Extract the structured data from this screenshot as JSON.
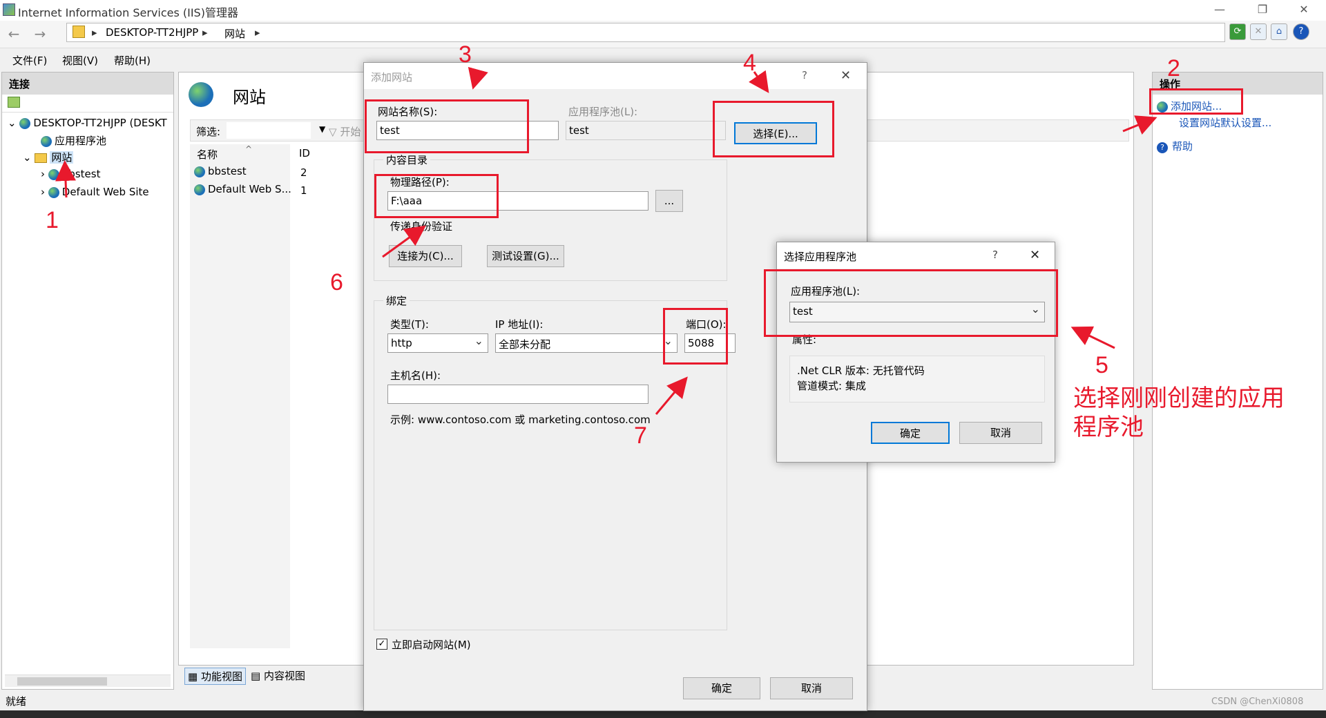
{
  "window": {
    "title": "Internet Information Services (IIS)管理器"
  },
  "address": {
    "crumbs": [
      "DESKTOP-TT2HJPP",
      "网站"
    ]
  },
  "menu": [
    "文件(F)",
    "视图(V)",
    "帮助(H)"
  ],
  "left": {
    "header": "连接",
    "tree": [
      "DESKTOP-TT2HJPP (DESKT",
      "应用程序池",
      "网站",
      "bbstest",
      "Default Web Site"
    ]
  },
  "center": {
    "title": "网站",
    "filter_label": "筛选:",
    "filter_go": "开始",
    "columns": [
      "名称",
      "ID"
    ],
    "rows": [
      {
        "name": "bbstest",
        "id": "2"
      },
      {
        "name": "Default Web S...",
        "id": "1"
      }
    ],
    "tabs": [
      "功能视图",
      "内容视图"
    ]
  },
  "right": {
    "header": "操作",
    "actions": [
      "添加网站...",
      "设置网站默认设置...",
      "帮助"
    ]
  },
  "status": "就绪",
  "add_site": {
    "title": "添加网站",
    "site_name_label": "网站名称(S):",
    "site_name": "test",
    "app_pool_label": "应用程序池(L):",
    "app_pool": "test",
    "select_btn": "选择(E)...",
    "content_dir": "内容目录",
    "physical_path_label": "物理路径(P):",
    "physical_path": "F:\\aaa",
    "browse_btn": "...",
    "pass_auth": "传递身份验证",
    "connect_as_btn": "连接为(C)...",
    "test_settings_btn": "测试设置(G)...",
    "binding": "绑定",
    "type_label": "类型(T):",
    "type": "http",
    "ip_label": "IP 地址(I):",
    "ip": "全部未分配",
    "port_label": "端口(O):",
    "port": "5088",
    "host_label": "主机名(H):",
    "host": "",
    "example": "示例: www.contoso.com 或 marketing.contoso.com",
    "start_now": "立即启动网站(M)",
    "ok": "确定",
    "cancel": "取消"
  },
  "select_pool": {
    "title": "选择应用程序池",
    "pool_label": "应用程序池(L):",
    "pool": "test",
    "props_label": "属性:",
    "clr": ".Net CLR 版本: 无托管代码",
    "pipeline": "管道模式: 集成",
    "ok": "确定",
    "cancel": "取消"
  },
  "annotations": {
    "n1": "1",
    "n2": "2",
    "n3": "3",
    "n4": "4",
    "n5": "5",
    "n6": "6",
    "n7": "7",
    "note": "选择刚刚创建的应用程序池",
    "color": "#e8192c"
  },
  "watermark": "CSDN @ChenXi0808"
}
